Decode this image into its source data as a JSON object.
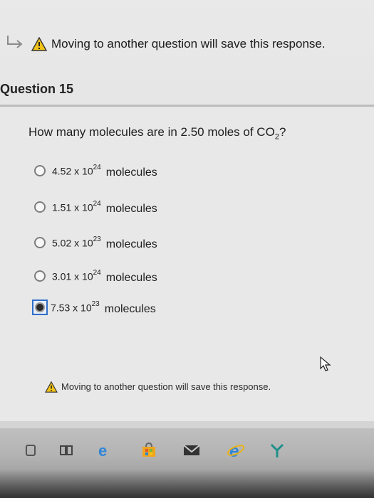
{
  "top_warning": {
    "text": "Moving to another question will save this response."
  },
  "question": {
    "header": "Question 15",
    "text_before": "How many molecules are in 2.50 moles of CO",
    "subscript": "2",
    "text_after": "?"
  },
  "options": [
    {
      "coef": "4.52 x 10",
      "exp": "24",
      "unit": "molecules",
      "selected": false
    },
    {
      "coef": "1.51 x 10",
      "exp": "24",
      "unit": "molecules",
      "selected": false
    },
    {
      "coef": "5.02 x 10",
      "exp": "23",
      "unit": "molecules",
      "selected": false
    },
    {
      "coef": "3.01 x 10",
      "exp": "24",
      "unit": "molecules",
      "selected": false
    },
    {
      "coef": "7.53 x 10",
      "exp": "23",
      "unit": "molecules",
      "selected": true
    }
  ],
  "bottom_warning": {
    "text": "Moving to another question will save this response."
  },
  "colors": {
    "warning_yellow": "#f2c318",
    "selection_blue": "#2f6fc8",
    "edge_blue": "#2f86d8"
  },
  "taskbar_icons": [
    "start-icon",
    "task-view-icon",
    "edge-icon",
    "store-icon",
    "mail-icon",
    "ie-icon",
    "settings-icon"
  ]
}
